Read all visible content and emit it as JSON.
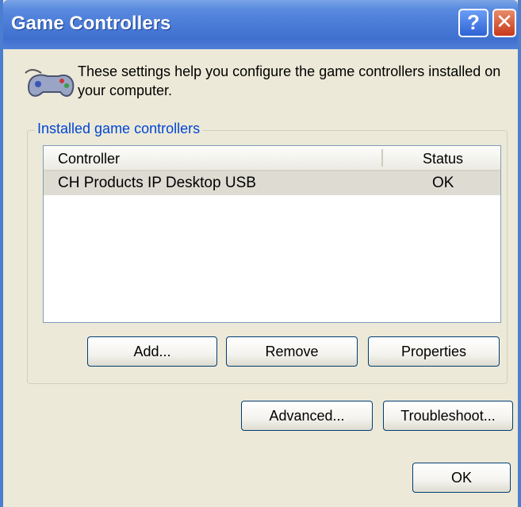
{
  "window": {
    "title": "Game Controllers",
    "help_label": "?",
    "close_label": "✕"
  },
  "intro_text": "These settings help you configure the game controllers installed on your computer.",
  "group": {
    "label": "Installed game controllers",
    "columns": [
      "Controller",
      "Status"
    ],
    "rows": [
      {
        "controller": "CH Products IP Desktop USB",
        "status": "OK"
      }
    ]
  },
  "buttons": {
    "add": "Add...",
    "remove": "Remove",
    "properties": "Properties",
    "advanced": "Advanced...",
    "troubleshoot": "Troubleshoot...",
    "ok": "OK"
  },
  "icons": {
    "gamepad": "gamepad-icon",
    "help": "help-icon",
    "close": "close-icon"
  },
  "colors": {
    "titlebar": "#4a7bd6",
    "group_label": "#0046d5",
    "dialog_bg": "#ece9d8"
  }
}
